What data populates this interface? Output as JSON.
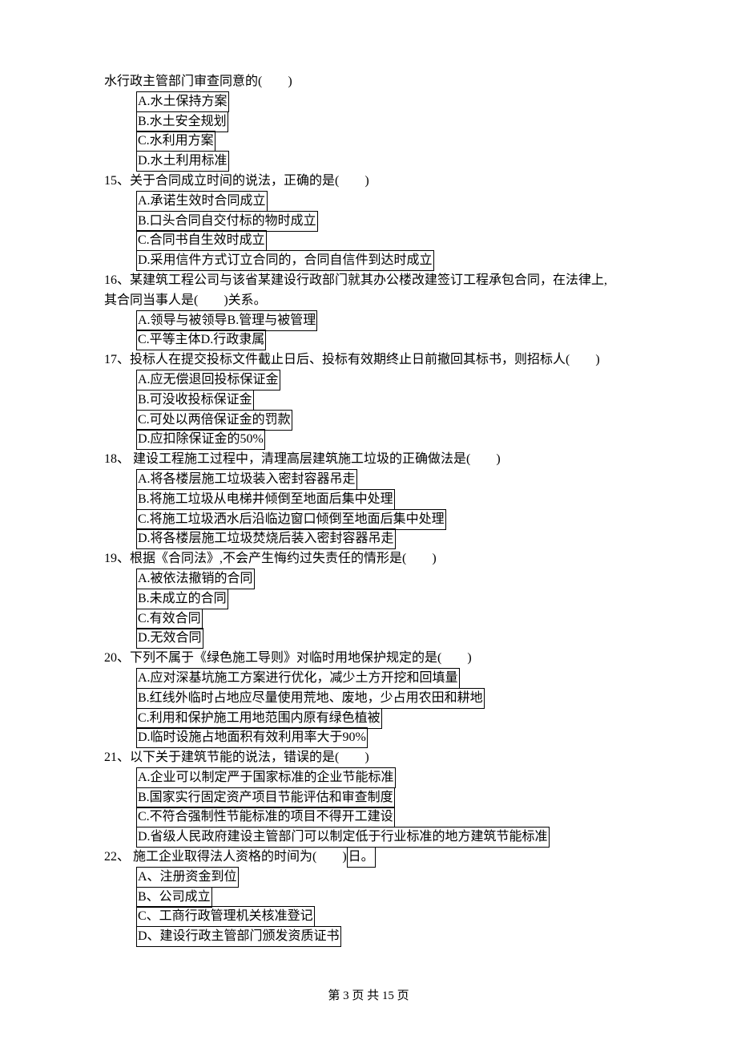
{
  "frag": {
    "line1": "水行政主管部门审查同意的(　　)",
    "a": "A.水土保持方案",
    "b": "B.水土安全规划",
    "c": "C.水利用方案",
    "d": "D.水土利用标准"
  },
  "q15": {
    "stem": "15、关于合同成立时间的说法，正确的是(　　)",
    "a": "A.承诺生效时合同成立",
    "b": "B.口头合同自交付标的物时成立",
    "c": "C.合同书自生效时成立",
    "d": "D.采用信件方式订立合同的，合同自信件到达时成立"
  },
  "q16": {
    "stem_l1": "16、某建筑工程公司与该省某建设行政部门就其办公楼改建签订工程承包合同，在法律上,",
    "stem_l2": "其合同当事人是(　　)关系。",
    "ab": "A.领导与被领导B.管理与被管理",
    "cd": "C.平等主体D.行政隶属"
  },
  "q17": {
    "stem": "17、投标人在提交投标文件截止日后、投标有效期终止日前撤回其标书，则招标人(　　)",
    "a": "A.应无偿退回投标保证金",
    "b": "B.可没收投标保证金",
    "c": "C.可处以两倍保证金的罚款",
    "d": "D.应扣除保证金的50%"
  },
  "q18": {
    "stem": "18、 建设工程施工过程中，清理高层建筑施工垃圾的正确做法是(　　)",
    "a": "A.将各楼层施工垃圾装入密封容器吊走",
    "b": "B.将施工垃圾从电梯井倾倒至地面后集中处理",
    "c": "C.将施工垃圾洒水后沿临边窗口倾倒至地面后集中处理",
    "d": "D.将各楼层施工垃圾焚烧后装入密封容器吊走"
  },
  "q19": {
    "stem": "19、根据《合同法》,不会产生悔约过失责任的情形是(　　)",
    "a": "A.被依法撤销的合同",
    "b": "B.未成立的合同",
    "c": "C.有效合同",
    "d": "D.无效合同"
  },
  "q20": {
    "stem": "20、下列不属于《绿色施工导则》对临时用地保护规定的是(　　)",
    "a": "A.应对深基坑施工方案进行优化，减少土方开挖和回填量",
    "b": "B.红线外临时占地应尽量使用荒地、废地，少占用农田和耕地",
    "c": "C.利用和保护施工用地范围内原有绿色植被",
    "d": "D.临时设施占地面积有效利用率大于90%"
  },
  "q21": {
    "stem": "21、以下关于建筑节能的说法，错误的是(　　)",
    "a": "A.企业可以制定严于国家标准的企业节能标准",
    "b": "B.国家实行固定资产项目节能评估和审查制度",
    "c": "C.不符合强制性节能标准的项目不得开工建设",
    "d": "D.省级人民政府建设主管部门可以制定低于行业标准的地方建筑节能标准"
  },
  "q22": {
    "stem_before": "22、 施工企业取得法人资格的时间为(　　)",
    "stem_after": "日。",
    "a": "A、注册资金到位",
    "b": "B、公司成立",
    "c": "C、工商行政管理机关核准登记",
    "d": "D、建设行政主管部门颁发资质证书"
  },
  "footer": "第 3 页 共 15 页"
}
